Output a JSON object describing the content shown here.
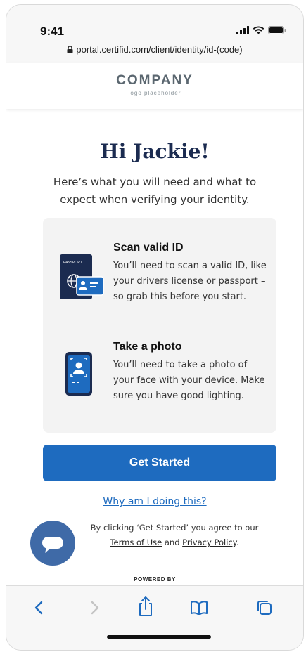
{
  "status_bar": {
    "time": "9:41"
  },
  "browser": {
    "url": "portal.certifid.com/client/identity/id-(code)"
  },
  "company": {
    "name": "COMPANY",
    "subtitle": "logo placeholder"
  },
  "main": {
    "greeting": "Hi Jackie!",
    "intro": "Here’s what you will need and what to expect when verifying your identity.",
    "steps": [
      {
        "icon": "passport-id-icon",
        "title": "Scan valid ID",
        "description": "You’ll need to scan a valid ID, like your drivers license or passport – so grab this before you start."
      },
      {
        "icon": "phone-selfie-icon",
        "title": "Take a photo",
        "description": "You’ll need to take a photo of your face with your device. Make sure you have good lighting."
      }
    ],
    "cta_label": "Get Started",
    "why_link": "Why am I doing this?",
    "terms": {
      "prefix": "By clicking ‘Get Started’ you agree to our",
      "terms_link": "Terms of Use",
      "and": "and",
      "privacy_link": "Privacy Policy",
      "suffix": "."
    },
    "powered_by": "POWERED BY"
  },
  "passport_label": "PASSPORT",
  "colors": {
    "primary": "#1e6bbf",
    "heading": "#1b2b50",
    "chat": "#3f6aa7",
    "card_bg": "#f3f3f3"
  },
  "toolbar_icons": [
    "back-icon",
    "forward-icon",
    "share-icon",
    "bookmarks-icon",
    "tabs-icon"
  ]
}
